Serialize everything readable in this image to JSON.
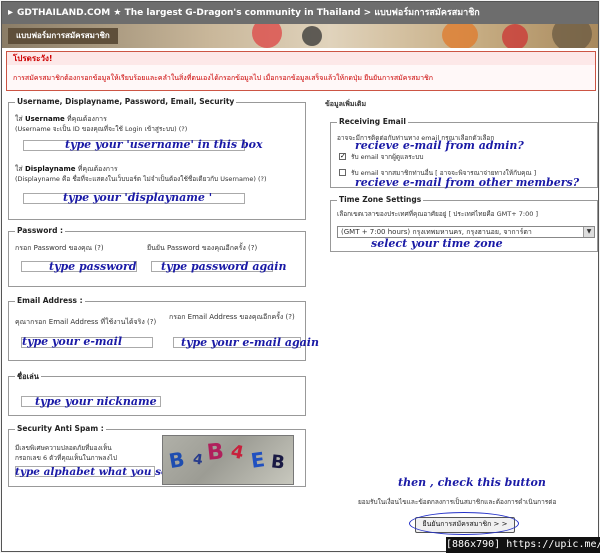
{
  "topbar": {
    "site": "GDTHAILAND.COM",
    "star": "★",
    "tagline": "The largest G-Dragon's community in Thailand",
    "sep": ">",
    "page": "แบบฟอร์มการสมัครสมาชิก"
  },
  "banner": {
    "tab": "แบบฟอร์มการสมัครสมาชิก"
  },
  "alert": {
    "title": "โปรดระวัง!",
    "message": "การสมัครสมาชิกต้องกรอกข้อมูลให้เรียบร้อยและคลำในสิ่งที่ตนเองได้กรอกข้อมูลไป เมื่อกรอกข้อมูลเสร็จแล้วให้กดปุ่ม ยืนยันการสมัครสมาชิก"
  },
  "account": {
    "legend": "Username, Displayname, Password, Email, Security",
    "username_label": "Username",
    "username_prefix": "ใส่",
    "username_req": "ที่คุณต้องการ",
    "username_help": "(Username จะเป็น ID ของคุณที่จะใช้ Login เข้าสู่ระบบ)   (?)",
    "username_hint": "type your 'username' in this box",
    "display_prefix": "ใส่",
    "display_label": "Displayname",
    "display_req": "ที่คุณต้องการ",
    "display_help": "(Displayname คือ ชื่อที่จะแสดงในเว็บบอร์ด ไม่จำเป็นต้องใช้ชื่อเดียวกับ Username)   (?)",
    "display_hint": "type your 'displayname '"
  },
  "password": {
    "legend": "Password :",
    "label1": "กรอก Password ของคุณ   (?)",
    "label2": "ยืนยัน Password ของคุณอีกครั้ง   (?)",
    "hint1": "type password",
    "hint2": "type password again"
  },
  "email": {
    "legend": "Email Address :",
    "label1": "คุณากรอก Email Address ที่ใช้งานได้จริง   (?)",
    "label2": "กรอก Email Address ของคุณอีกครั้ง   (?)",
    "hint1": "type your e-mail",
    "hint2": "type your e-mail again"
  },
  "nickname": {
    "legend": "ชื่อเล่น",
    "hint": "type your nickname"
  },
  "security": {
    "legend": "Security Anti Spam :",
    "help1": "มีเลขพิเศษความปลอดภัยที่มองเห็น",
    "help2": "กรอกเลข 6 ตัวที่คุณเห็นในภาพลงไป",
    "hint": "type alphabet what you see",
    "captcha": [
      "B",
      "4",
      "B",
      "4",
      "E",
      "B"
    ]
  },
  "more_info": {
    "title": "ข้อมูลเพิ่มเติม"
  },
  "receiving": {
    "legend": "Receiving Email",
    "desc": "อาจจะมีการติดต่อกับท่านทาง email กรุณาเลือกตัวเลือก",
    "opt1": "รับ email จากผู้ดูแลระบบ",
    "opt2": "รับ email จากสมาชิกท่านอื่น [ อาจจะพิจารณาจ่ายทางให้กับคุณ ]",
    "opt1_checked": "✓",
    "hint1": "recieve e-mail from admin?",
    "hint2": "recieve e-mail from other members?"
  },
  "timezone": {
    "legend": "Time Zone Settings",
    "desc": "เลือกเขตเวลาของประเทศที่คุณอาศัยอยู่ [ ประเทศไทยคือ GMT+ 7:00 ]",
    "selected": "(GMT + 7:00 hours) กรุงเทพมหานคร, กรุงฮานอย, จาการ์ตา",
    "hint": "select your time zone"
  },
  "footer": {
    "hint": "then , check this button",
    "agree": "ยอมรับในเงื่อนไขและข้อตกลงการเป็นสมาชิกและต้องการดำเนินการต่อ",
    "submit": "ยืนยันการสมัครสมาชิก > >"
  },
  "watermark": "[886x790] https://upic.me/"
}
